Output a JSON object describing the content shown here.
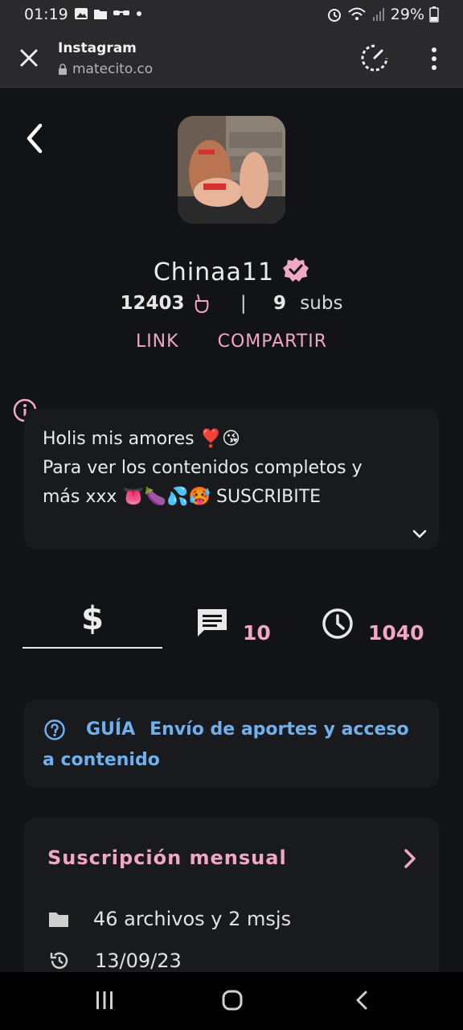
{
  "status_bar": {
    "time": "01:19",
    "battery": "29%"
  },
  "browser": {
    "title": "Instagram",
    "url": "matecito.co"
  },
  "profile": {
    "name": "Chinaa11",
    "mates_count": "12403",
    "separator": "|",
    "subs_count": "9",
    "subs_label": "subs",
    "link_label": "LINK",
    "share_label": "COMPARTIR"
  },
  "bio": {
    "line1": "Holis mis amores ❣️😘",
    "line2": "Para ver los contenidos completos y",
    "line3": "más xxx 👅🍆💦🥵 SUSCRIBITE"
  },
  "tabs": {
    "dollar_symbol": "$",
    "messages_count": "10",
    "time_count": "1040"
  },
  "guide": {
    "label": "GUÍA",
    "text": "Envío de aportes y acceso a contenido"
  },
  "subscription": {
    "title": "Suscripción mensual",
    "files": "46 archivos y 2 msjs",
    "date": "13/09/23"
  },
  "colors": {
    "accent_pink": "#f2a7c3",
    "accent_blue": "#6fb0ef",
    "background": "#121316",
    "card": "#181a1e"
  },
  "icons": [
    "close-icon",
    "lock-icon",
    "speed-icon",
    "menu-icon",
    "back-icon",
    "verified-icon",
    "mate-icon",
    "info-icon",
    "chevron-down-icon",
    "dollar-icon",
    "message-icon",
    "clock-icon",
    "help-icon",
    "chevron-right-icon",
    "folder-icon",
    "history-icon"
  ]
}
